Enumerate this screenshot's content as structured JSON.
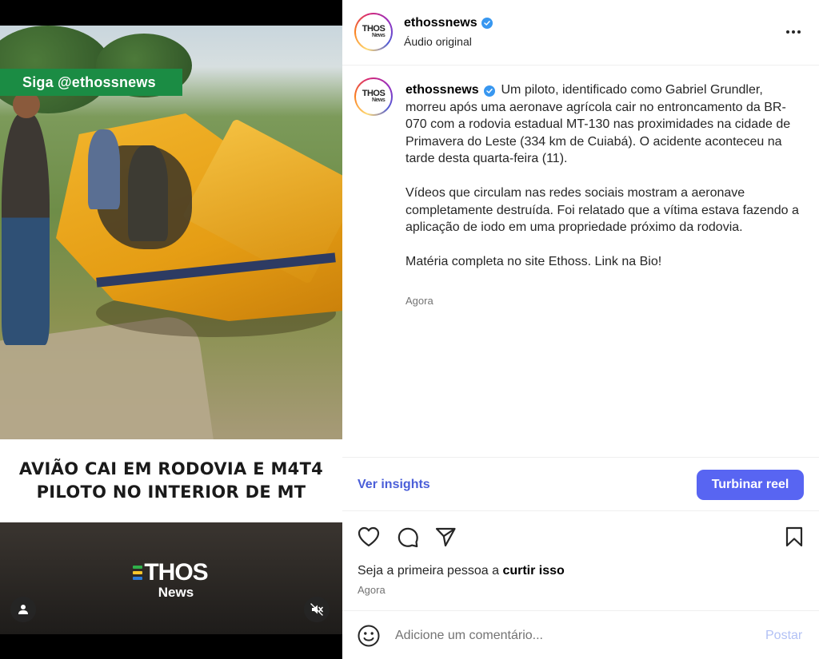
{
  "media": {
    "follow_tag": "Siga @ethossnews",
    "headline": [
      "AVIÃO CAI EM RODOVIA E M4T4",
      "PILOTO NO INTERIOR DE MT"
    ],
    "brand": {
      "name": "THOS",
      "sub": "News",
      "e_colors": [
        "#2fb04a",
        "#f7c52b",
        "#2b7ad8"
      ]
    },
    "icons": {
      "user": "user-icon",
      "mute": "muted-speaker-icon"
    }
  },
  "post": {
    "username": "ethossnews",
    "audio": "Áudio original",
    "avatar_text": "THOS",
    "avatar_sub": "News",
    "caption": {
      "p1": "Um piloto, identificado como Gabriel Grundler, morreu após uma aeronave agrícola cair no entroncamento da BR-070 com a rodovia estadual MT-130 nas proximidades na cidade de Primavera do Leste (334 km de Cuiabá). O acidente aconteceu na tarde desta quarta-feira (11).",
      "p2": "Vídeos que circulam nas redes sociais mostram a aeronave completamente destruída. Foi relatado que a vítima estava fazendo a aplicação de iodo em uma propriedade próximo da rodovia.",
      "p3": "Matéria completa no site Ethoss. Link na Bio!"
    },
    "caption_time": "Agora",
    "insights_label": "Ver insights",
    "boost_label": "Turbinar reel",
    "likes_prefix": "Seja a primeira pessoa a ",
    "likes_action": "curtir isso",
    "likes_time": "Agora",
    "comment_placeholder": "Adicione um comentário...",
    "post_label": "Postar"
  },
  "colors": {
    "accent": "#5865f2",
    "link": "#4a5ed8",
    "verified": "#3897f0",
    "follow_tag": "#1b8c44"
  }
}
